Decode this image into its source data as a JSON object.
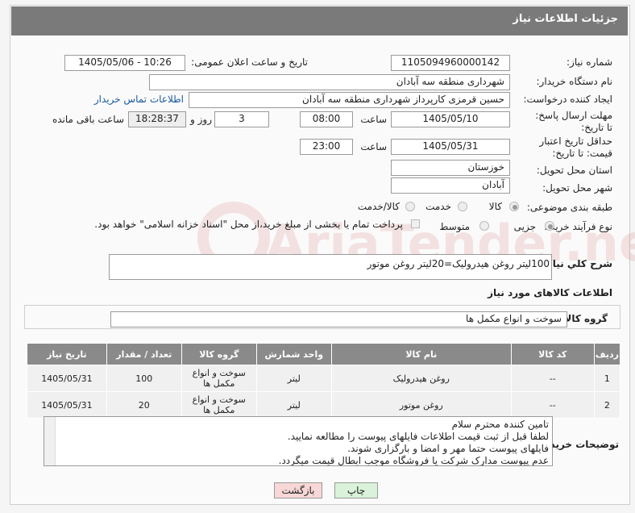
{
  "header": {
    "title": "جزئیات اطلاعات نیاز"
  },
  "fields": {
    "need_number_label": "شماره نیاز:",
    "need_number": "1105094960000142",
    "announce_label": "تاریخ و ساعت اعلان عمومی:",
    "announce_value": "1405/05/06 - 10:26",
    "buyer_label": "نام دستگاه خریدار:",
    "buyer_value": "شهرداری منطقه سه آبادان",
    "creator_label": "ایجاد کننده درخواست:",
    "creator_value": "حسین قرمزی کارپرداز شهرداری منطقه سه آبادان",
    "contact_link": "اطلاعات تماس خریدار",
    "deadline_label": "مهلت ارسال پاسخ: تا تاریخ:",
    "deadline_date": "1405/05/10",
    "time_label": "ساعت",
    "deadline_time": "08:00",
    "days_value": "3",
    "days_label": "روز و",
    "remaining_time": "18:28:37",
    "remaining_label": "ساعت باقی مانده",
    "validity_label": "حداقل تاریخ اعتبار قیمت: تا تاریخ:",
    "validity_date": "1405/05/31",
    "validity_time": "23:00",
    "province_label": "استان محل تحویل:",
    "province_value": "خوزستان",
    "city_label": "شهر محل تحویل:",
    "city_value": "آبادان",
    "category_label": "طبقه بندی موضوعی:",
    "category_options": [
      "کالا",
      "خدمت",
      "کالا/خدمت"
    ],
    "category_selected": "کالا",
    "process_label": "نوع فرآیند خرید :",
    "process_options": [
      "جزیی",
      "متوسط"
    ],
    "process_selected": "جزیی",
    "payment_note": "پرداخت تمام یا بخشی از مبلغ خرید،از محل \"اسناد خزانه اسلامی\" خواهد بود."
  },
  "description": {
    "label": "شرح کلي نياز:",
    "value": "100لیتر روغن هیدرولیک=20لیتر روغن موتور"
  },
  "goods": {
    "section_title": "اطلاعات کالاهای مورد نیاز",
    "group_label": "گروه کالا:",
    "group_value": "سوخت و انواع مکمل ها",
    "columns": [
      "ردیف",
      "کد کالا",
      "نام کالا",
      "واحد شمارش",
      "گروه کالا",
      "تعداد / مقدار",
      "تاریخ نیاز"
    ],
    "rows": [
      {
        "row": "1",
        "code": "--",
        "name": "روغن هیدرولیک",
        "unit": "لیتر",
        "group": "سوخت و انواع مکمل ها",
        "qty": "100",
        "date": "1405/05/31"
      },
      {
        "row": "2",
        "code": "--",
        "name": "روغن موتور",
        "unit": "لیتر",
        "group": "سوخت و انواع مکمل ها",
        "qty": "20",
        "date": "1405/05/31"
      }
    ]
  },
  "buyer_notes": {
    "label": "توضیحات خریدار:",
    "lines": [
      "تامین کنندہ محترم سلام",
      "لطفا قبل از ثبت قیمت اطلاعات فایلهای پیوست را مطالعه نمایید.",
      "فایلهای پیوست حتما مهر و امضا و بارگزاری شوند.",
      "عدم پیوست مدارک شرکت یا فروشگاه موجب ابطال قیمت میگردد."
    ]
  },
  "buttons": {
    "print": "چاپ",
    "back": "بازگشت"
  },
  "watermark": "AriaTender.net",
  "colors": {
    "header_bg": "#7a7a7a",
    "table_header_bg": "#8a8a8a",
    "back_button_bg": "#f8d7d7",
    "print_button_bg": "#d9f2d9",
    "link": "#1a5aa0"
  }
}
